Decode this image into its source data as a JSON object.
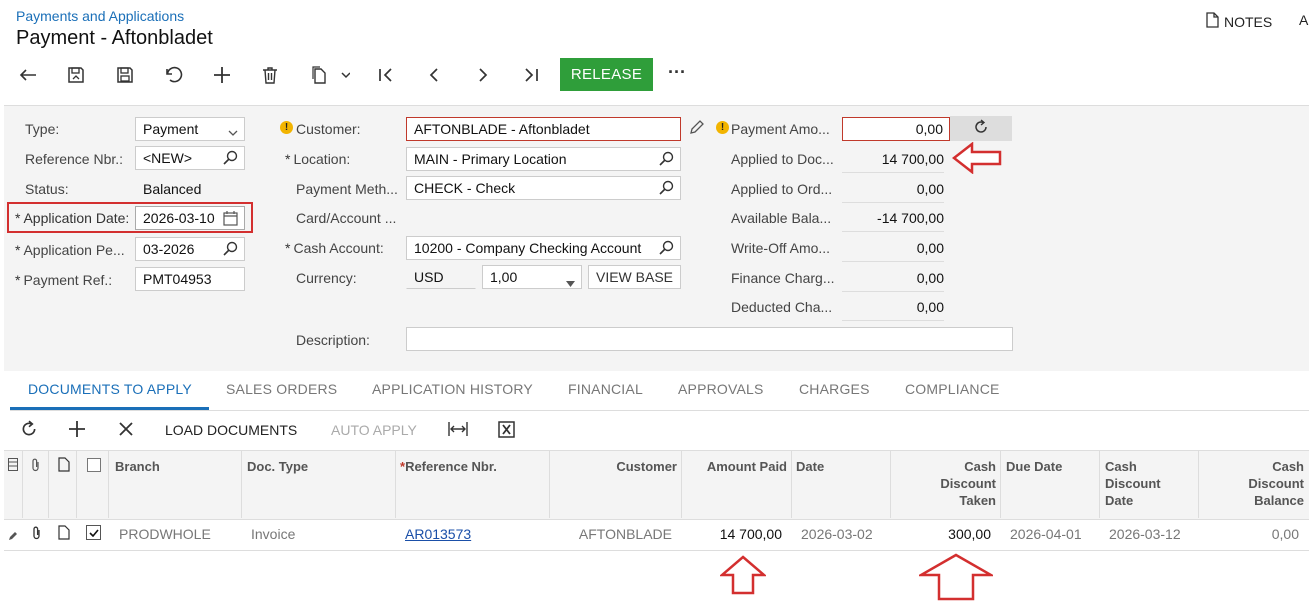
{
  "header": {
    "breadcrumb": "Payments and Applications",
    "title": "Payment - Aftonbladet",
    "notes_label": "NOTES",
    "notes_extra": "A"
  },
  "toolbar": {
    "release_label": "RELEASE",
    "more_label": "···"
  },
  "form": {
    "type_label": "Type:",
    "type_value": "Payment",
    "refnbr_label": "Reference Nbr.:",
    "refnbr_value": "<NEW>",
    "status_label": "Status:",
    "status_value": "Balanced",
    "appdate_label": "Application Date:",
    "appdate_value": "2026-03-10",
    "appperiod_label": "Application Pe...",
    "appperiod_value": "03-2026",
    "payref_label": "Payment Ref.:",
    "payref_value": "PMT04953",
    "customer_label": "Customer:",
    "customer_value": "AFTONBLADE - Aftonbladet",
    "location_label": "Location:",
    "location_value": "MAIN - Primary Location",
    "paymeth_label": "Payment Meth...",
    "paymeth_value": "CHECK - Check",
    "card_label": "Card/Account ...",
    "cashacct_label": "Cash Account:",
    "cashacct_value": "10200 - Company Checking Account",
    "currency_label": "Currency:",
    "currency_value": "USD",
    "rate_value": "1,00",
    "view_base_label": "VIEW BASE",
    "description_label": "Description:",
    "description_value": "",
    "payamt_label": "Payment Amo...",
    "payamt_value": "0,00",
    "applied_doc_label": "Applied to Doc...",
    "applied_doc_value": "14 700,00",
    "applied_ord_label": "Applied to Ord...",
    "applied_ord_value": "0,00",
    "avail_label": "Available Bala...",
    "avail_value": "-14 700,00",
    "writeoff_label": "Write-Off Amo...",
    "writeoff_value": "0,00",
    "finance_label": "Finance Charg...",
    "finance_value": "0,00",
    "deducted_label": "Deducted Cha...",
    "deducted_value": "0,00"
  },
  "tabs": [
    "DOCUMENTS TO APPLY",
    "SALES ORDERS",
    "APPLICATION HISTORY",
    "FINANCIAL",
    "APPROVALS",
    "CHARGES",
    "COMPLIANCE"
  ],
  "grid_toolbar": {
    "load_label": "LOAD DOCUMENTS",
    "auto_label": "AUTO APPLY"
  },
  "grid": {
    "columns": {
      "branch": "Branch",
      "doctype": "Doc. Type",
      "refnbr": "Reference Nbr.",
      "customer": "Customer",
      "amount_paid": "Amount Paid",
      "date": "Date",
      "cash_disc_taken": "Cash Discount Taken",
      "due_date": "Due Date",
      "cash_disc_date": "Cash Discount Date",
      "cash_disc_balance": "Cash Discount Balance"
    },
    "rows": [
      {
        "branch": "PRODWHOLE",
        "doctype": "Invoice",
        "refnbr": "AR013573",
        "customer": "AFTONBLADE",
        "amount_paid": "14 700,00",
        "date": "2026-03-02",
        "cash_disc_taken": "300,00",
        "due_date": "2026-04-01",
        "cash_disc_date": "2026-03-12",
        "cash_disc_balance": "0,00"
      }
    ]
  },
  "colors": {
    "accent": "#1a6fb8",
    "release": "#2f9e3a",
    "annotation": "#d32f2f",
    "warning": "#f2b400"
  }
}
